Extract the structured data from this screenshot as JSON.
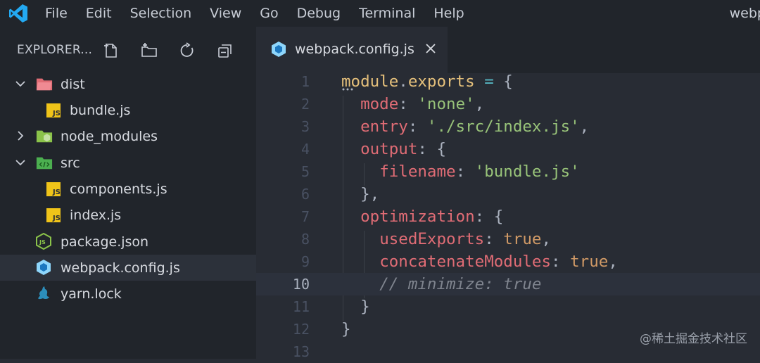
{
  "menubar": {
    "items": [
      "File",
      "Edit",
      "Selection",
      "View",
      "Go",
      "Debug",
      "Terminal",
      "Help"
    ],
    "window_title": "webp"
  },
  "explorer": {
    "title": "EXPLORER...",
    "actions": [
      "new-file-icon",
      "new-folder-icon",
      "refresh-icon",
      "collapse-all-icon"
    ],
    "tree": [
      {
        "label": "dist",
        "type": "folder",
        "expanded": true
      },
      {
        "label": "bundle.js",
        "type": "js"
      },
      {
        "label": "node_modules",
        "type": "folder",
        "expanded": false
      },
      {
        "label": "src",
        "type": "folder",
        "expanded": true
      },
      {
        "label": "components.js",
        "type": "js"
      },
      {
        "label": "index.js",
        "type": "js"
      },
      {
        "label": "package.json",
        "type": "npm"
      },
      {
        "label": "webpack.config.js",
        "type": "webpack",
        "selected": true
      },
      {
        "label": "yarn.lock",
        "type": "yarn"
      }
    ]
  },
  "tab": {
    "label": "webpack.config.js"
  },
  "editor": {
    "line_numbers": [
      "1",
      "2",
      "3",
      "4",
      "5",
      "6",
      "7",
      "8",
      "9",
      "10",
      "11",
      "12",
      "13"
    ],
    "current_line": "10",
    "lines": [
      "module.exports = {",
      "  mode: 'none',",
      "  entry: './src/index.js',",
      "  output: {",
      "    filename: 'bundle.js'",
      "  },",
      "  optimization: {",
      "    usedExports: true,",
      "    concatenateModules: true,",
      "    // minimize: true",
      "  }",
      "}",
      ""
    ]
  },
  "watermark": "@稀土掘金技术社区",
  "colors": {
    "bg_editor": "#282c34",
    "bg_sidebar": "#21252b",
    "keyword_yellow": "#e5c07b",
    "property_red": "#e06c75",
    "string_green": "#98c379",
    "boolean_orange": "#d19a66",
    "vscode_blue": "#23a9f2"
  }
}
